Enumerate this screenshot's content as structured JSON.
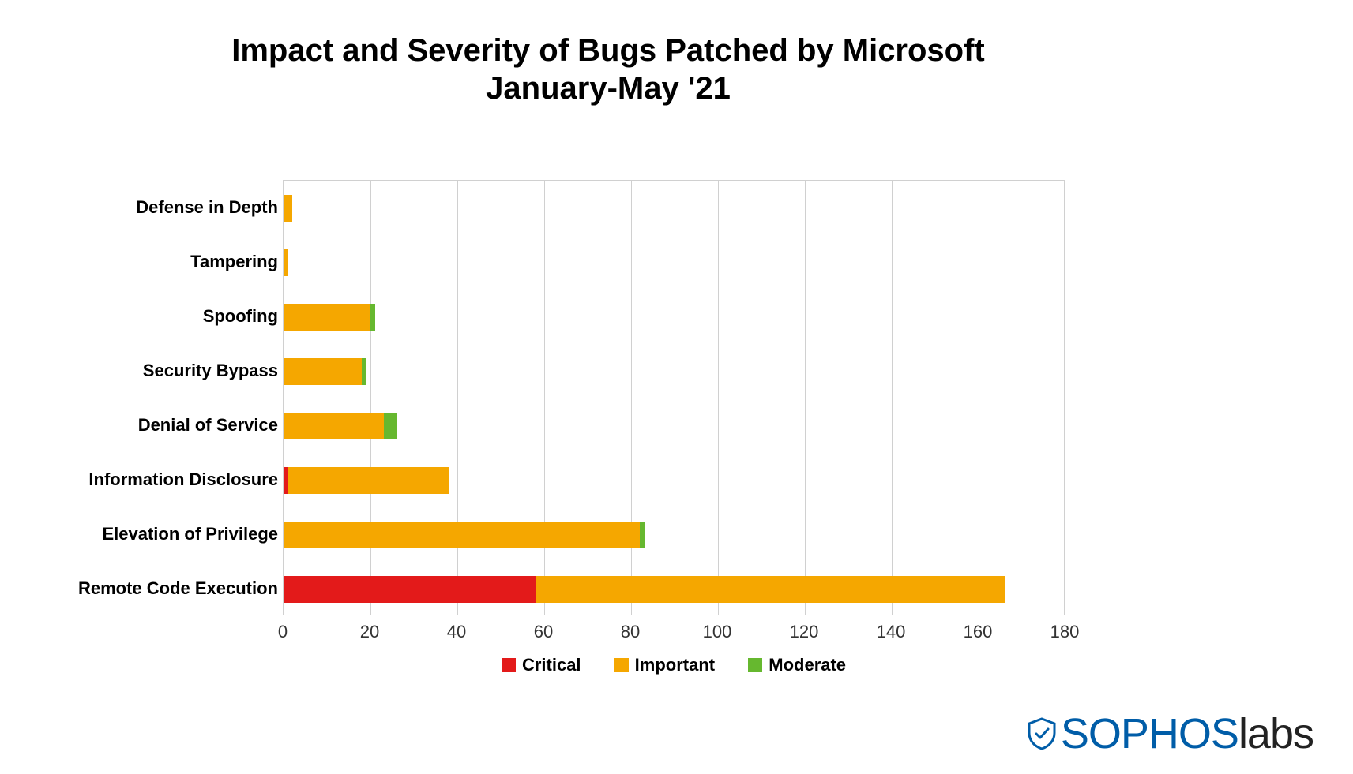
{
  "title_line1": "Impact and Severity of Bugs Patched by Microsoft",
  "title_line2": "January-May '21",
  "chart_data": {
    "type": "bar",
    "orientation": "horizontal",
    "stacked": true,
    "xlabel": "",
    "ylabel": "",
    "title": "Impact and Severity of Bugs Patched by Microsoft January-May '21",
    "xlim": [
      0,
      180
    ],
    "xticks": [
      0,
      20,
      40,
      60,
      80,
      100,
      120,
      140,
      160,
      180
    ],
    "categories": [
      "Defense in Depth",
      "Tampering",
      "Spoofing",
      "Security Bypass",
      "Denial of Service",
      "Information Disclosure",
      "Elevation of Privilege",
      "Remote Code Execution"
    ],
    "series": [
      {
        "name": "Critical",
        "color": "#e31a1a",
        "values": [
          0,
          0,
          0,
          0,
          0,
          1,
          0,
          58
        ]
      },
      {
        "name": "Important",
        "color": "#f5a700",
        "values": [
          2,
          1,
          20,
          18,
          23,
          37,
          82,
          108
        ]
      },
      {
        "name": "Moderate",
        "color": "#66b82f",
        "values": [
          0,
          0,
          1,
          1,
          3,
          0,
          1,
          0
        ]
      }
    ],
    "legend_position": "bottom"
  },
  "legend": {
    "critical": "Critical",
    "important": "Important",
    "moderate": "Moderate"
  },
  "logo": {
    "brand": "SOPHOS",
    "suffix": "labs"
  }
}
